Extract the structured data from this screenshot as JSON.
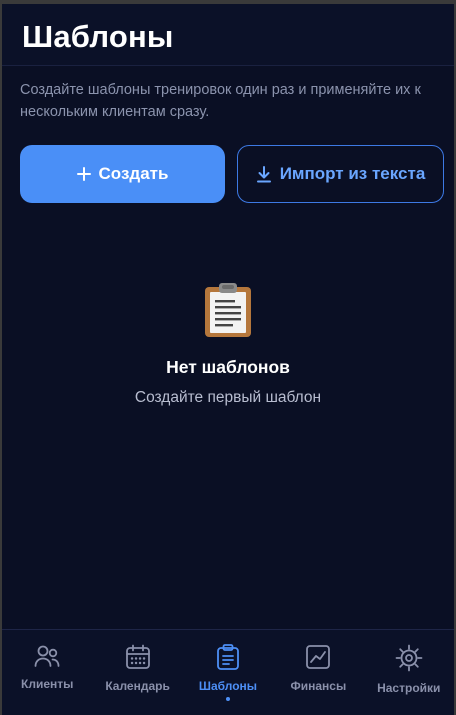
{
  "header": {
    "title": "Шаблоны"
  },
  "intro": {
    "text": "Создайте шаблоны тренировок один раз и применяйте их к нескольким клиентам сразу."
  },
  "actions": {
    "create_label": "Создать",
    "import_label": "Импорт из текста"
  },
  "empty_state": {
    "icon": "clipboard-icon",
    "title": "Нет шаблонов",
    "subtitle": "Создайте первый шаблон"
  },
  "tabbar": {
    "active": "Шаблоны",
    "items": [
      {
        "label": "Клиенты",
        "icon": "users-icon"
      },
      {
        "label": "Календарь",
        "icon": "calendar-icon"
      },
      {
        "label": "Шаблоны",
        "icon": "clipboard-icon"
      },
      {
        "label": "Финансы",
        "icon": "chart-icon"
      },
      {
        "label": "Настройки",
        "icon": "gear-icon"
      }
    ]
  },
  "colors": {
    "background": "#0a0f24",
    "accent": "#4a8ff7",
    "text_muted": "#8b93ad"
  }
}
